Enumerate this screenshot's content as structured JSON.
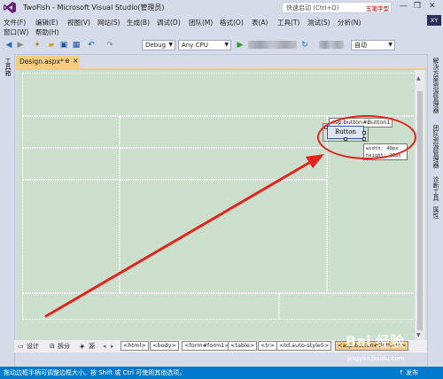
{
  "window": {
    "title": "TwoFish - Microsoft Visual Studio(管理员)",
    "quick_launch_placeholder": "快速启动 (Ctrl+Q)",
    "ad_text": "五笔字型",
    "user_initials": "XY"
  },
  "menu": {
    "row1": [
      "文件(F)",
      "编辑(E)",
      "视图(V)",
      "网站(S)",
      "生成(B)",
      "调试(D)",
      "团队(M)",
      "格式(O)",
      "表(A)",
      "工具(T)",
      "测试(S)",
      "分析(N)"
    ],
    "row2": [
      "窗口(W)",
      "帮助(H)"
    ]
  },
  "toolbar": {
    "config": "Debug",
    "platform": "Any CPU",
    "auto": "自动"
  },
  "left_panel": {
    "toolbox": "工具箱"
  },
  "right_panel": {
    "items": [
      "解决方案资源管理器",
      "团队资源管理器",
      "诊断工具",
      "属性"
    ]
  },
  "document_tab": {
    "label": "Design.aspx*",
    "pin": "⊕",
    "close": "×"
  },
  "control": {
    "tag_label": "asp:button#Button1",
    "button_text": "Button",
    "size_tip_width": "width: 40px",
    "size_tip_height": "height: 21px"
  },
  "bottom": {
    "design": "设计",
    "split": "拆分",
    "source": "源",
    "crumbs": [
      "<html>",
      "<body>",
      "<form#form1>",
      "<table>",
      "<tr>",
      "<td.auto-style5>",
      "<asp:button#Button1>"
    ]
  },
  "status": {
    "message": "拖动边框手柄可调整边框大小。按 Shift 或 Ctrl 可使用其他选项。",
    "publish": "↑ 发布"
  },
  "watermark": {
    "logo": "Bai 经验",
    "url": "jingyan.baidu.com"
  },
  "colors": {
    "design_bg": "#ccdfcc",
    "tab_active": "#f5cc84",
    "status_bar": "#007acc",
    "annotation_red": "#e4231c"
  },
  "icons": [
    "vs-logo-icon",
    "back-icon",
    "forward-icon",
    "new-project-icon",
    "open-icon",
    "save-icon",
    "save-all-icon",
    "undo-icon",
    "redo-icon",
    "start-icon",
    "refresh-icon",
    "minimize-icon",
    "restore-icon",
    "close-icon",
    "red-arrow-annotation"
  ]
}
